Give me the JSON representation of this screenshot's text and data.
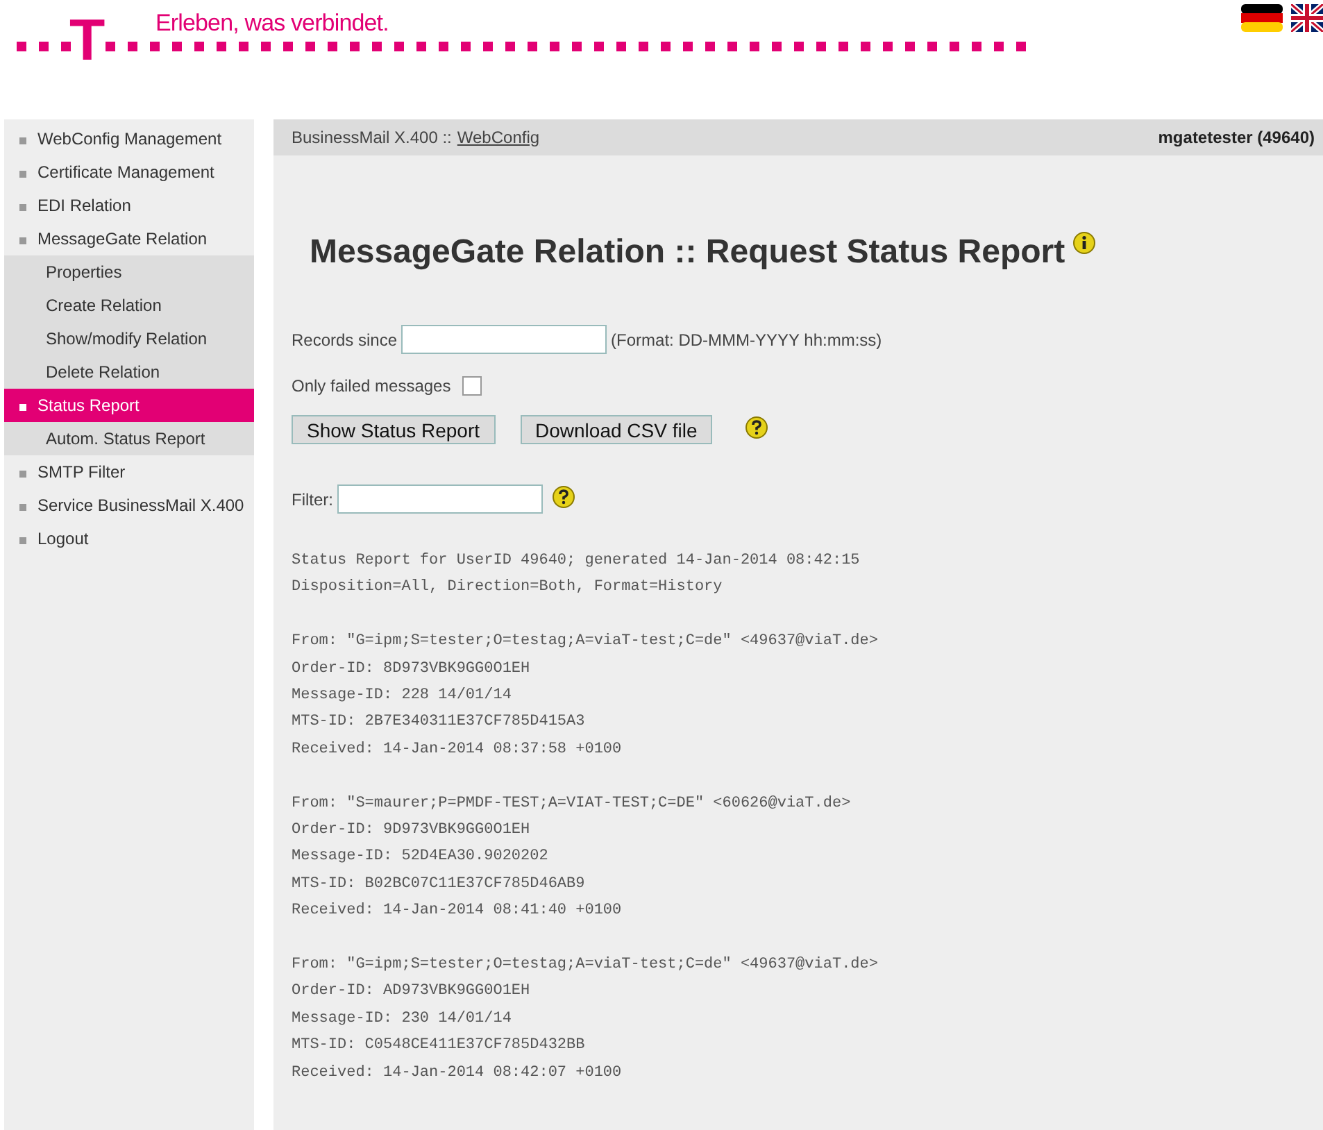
{
  "brand": {
    "logo_letter": "T",
    "tagline": "Erleben, was verbindet."
  },
  "sidebar": {
    "items": [
      {
        "label": "WebConfig Management",
        "selected": false
      },
      {
        "label": "Certificate Management",
        "selected": false
      },
      {
        "label": "EDI Relation",
        "selected": false
      },
      {
        "label": "MessageGate Relation",
        "selected": false,
        "children": [
          {
            "label": "Properties",
            "selected": false
          },
          {
            "label": "Create Relation",
            "selected": false
          },
          {
            "label": "Show/modify Relation",
            "selected": false
          },
          {
            "label": "Delete Relation",
            "selected": false
          },
          {
            "label": "Status Report",
            "selected": true
          },
          {
            "label": "Autom. Status Report",
            "selected": false
          }
        ]
      },
      {
        "label": "SMTP Filter",
        "selected": false
      },
      {
        "label": "Service BusinessMail X.400",
        "selected": false
      },
      {
        "label": "Logout",
        "selected": false
      }
    ]
  },
  "header": {
    "breadcrumb_prefix": "BusinessMail X.400 ::",
    "breadcrumb_link": "WebConfig",
    "user": "mgatetester (49640)"
  },
  "title": "MessageGate Relation :: Request Status Report",
  "form": {
    "records_since_label": "Records since",
    "records_since_hint": "(Format: DD-MMM-YYYY hh:mm:ss)",
    "only_failed_label": "Only failed messages",
    "only_failed_checked": false,
    "buttons": [
      "Show Status Report",
      "Download CSV file"
    ],
    "filter_label": "Filter:"
  },
  "report": {
    "header": [
      "Status Report for UserID 49640; generated 14-Jan-2014 08:42:15",
      "Disposition=All, Direction=Both, Format=History"
    ],
    "entries": [
      [
        "From: \"G=ipm;S=tester;O=testag;A=viaT-test;C=de\" <49637@viaT.de>",
        "Order-ID: 8D973VBK9GG0O1EH",
        "Message-ID: 228 14/01/14",
        "MTS-ID: 2B7E340311E37CF785D415A3",
        "Received: 14-Jan-2014 08:37:58 +0100"
      ],
      [
        "From: \"S=maurer;P=PMDF-TEST;A=VIAT-TEST;C=DE\" <60626@viaT.de>",
        "Order-ID: 9D973VBK9GG0O1EH",
        "Message-ID: 52D4EA30.9020202",
        "MTS-ID: B02BC07C11E37CF785D46AB9",
        "Received: 14-Jan-2014 08:41:40 +0100"
      ],
      [
        "From: \"G=ipm;S=tester;O=testag;A=viaT-test;C=de\" <49637@viaT.de>",
        "Order-ID: AD973VBK9GG0O1EH",
        "Message-ID: 230 14/01/14",
        "MTS-ID: C0548CE411E37CF785D432BB",
        "Received: 14-Jan-2014 08:42:07 +0100"
      ]
    ]
  }
}
